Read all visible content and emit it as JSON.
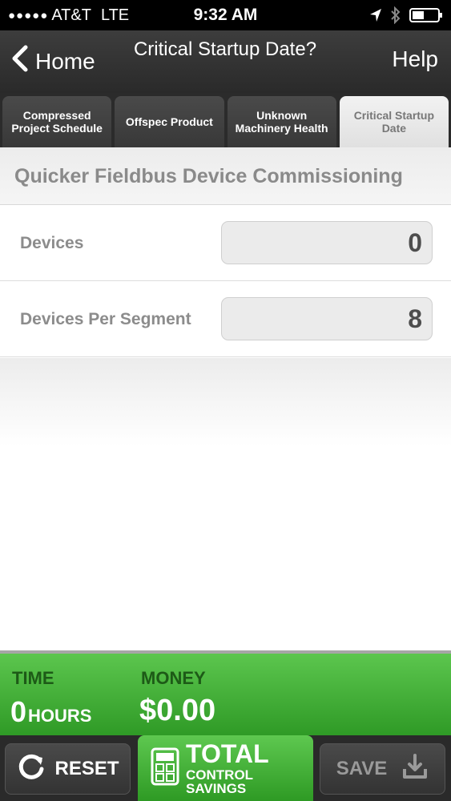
{
  "status_bar": {
    "signal": "●●●●●",
    "carrier": "AT&T",
    "network": "LTE",
    "time": "9:32 AM"
  },
  "nav": {
    "back_label": "Home",
    "title": "Critical Startup Date?",
    "help_label": "Help"
  },
  "tabs": [
    {
      "label": "Compressed Project Schedule",
      "active": false
    },
    {
      "label": "Offspec Product",
      "active": false
    },
    {
      "label": "Unknown Machinery Health",
      "active": false
    },
    {
      "label": "Critical Startup Date",
      "active": true
    }
  ],
  "section": {
    "title": "Quicker Fieldbus Device Commissioning"
  },
  "fields": [
    {
      "label": "Devices",
      "value": "0"
    },
    {
      "label": "Devices Per Segment",
      "value": "8"
    }
  ],
  "savings": {
    "time_label": "TIME",
    "time_value": "0",
    "time_unit": "HOURS",
    "money_label": "MONEY",
    "money_value": "$0.00"
  },
  "toolbar": {
    "reset_label": "RESET",
    "total_main": "TOTAL",
    "total_sub": "CONTROL SAVINGS",
    "save_label": "SAVE"
  },
  "colors": {
    "accent_green": "#3faf34",
    "dark_bar": "#2a2a2a"
  },
  "icons": [
    "location-arrow-icon",
    "bluetooth-icon",
    "battery-icon",
    "back-chevron-icon",
    "refresh-icon",
    "calculator-icon",
    "download-icon"
  ]
}
